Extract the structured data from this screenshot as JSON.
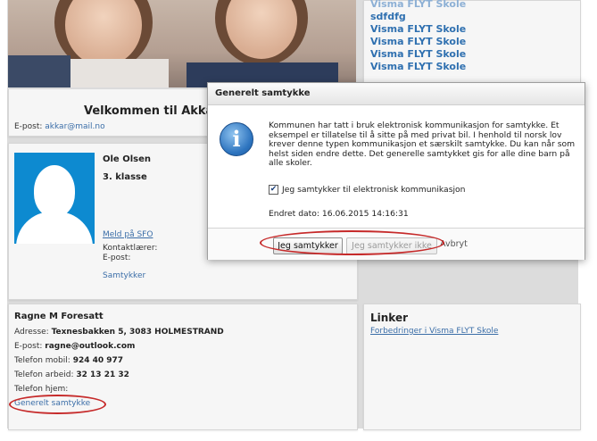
{
  "top_links": [
    "Visma FLYT Skole",
    "sdfdfg",
    "Visma FLYT Skole",
    "Visma FLYT Skole",
    "Visma FLYT Skole",
    "Visma FLYT Skole"
  ],
  "welcome": {
    "title": "Velkommen til Akka",
    "email_label": "E-post:",
    "email": "akkar@mail.no"
  },
  "child": {
    "name": "Ole Olsen",
    "class": "3. klasse",
    "sfo_link": "Meld på SFO",
    "contact_teacher_label": "Kontaktlærer:",
    "email_label": "E-post:",
    "consent_link": "Samtykker"
  },
  "guardian": {
    "name": "Ragne M Foresatt",
    "address_label": "Adresse:",
    "address": "Texnesbakken 5, 3083 HOLMESTRAND",
    "email_label": "E-post:",
    "email": "ragne@outlook.com",
    "mobile_label": "Telefon mobil:",
    "mobile": "924 40 977",
    "work_label": "Telefon arbeid:",
    "work": "32 13 21 32",
    "home_label": "Telefon hjem:",
    "consent_link": "Generelt samtykke"
  },
  "links_panel": {
    "title": "Linker",
    "link": "Forbedringer i Visma FLYT Skole"
  },
  "dialog": {
    "title": "Generelt samtykke",
    "text": "Kommunen har tatt i bruk elektronisk kommunikasjon for samtykke. Et eksempel er tillatelse til å sitte på med privat bil. I henhold til norsk lov krever denne typen kommunikasjon et særskilt samtykke. Du kan når som helst siden endre dette. Det generelle samtykket gis for alle dine barn på alle skoler.",
    "checkbox_label": "Jeg samtykker til elektronisk kommunikasjon",
    "checked": true,
    "changed_date": "Endret dato: 16.06.2015 14:16:31",
    "btn_accept": "Jeg samtykker",
    "btn_decline": "Jeg samtykker ikke",
    "btn_cancel": "Avbryt"
  },
  "colors": {
    "link": "#3b6ea8",
    "accent_highlight": "#c62a2a",
    "avatar_bg": "#0d8ad0"
  }
}
